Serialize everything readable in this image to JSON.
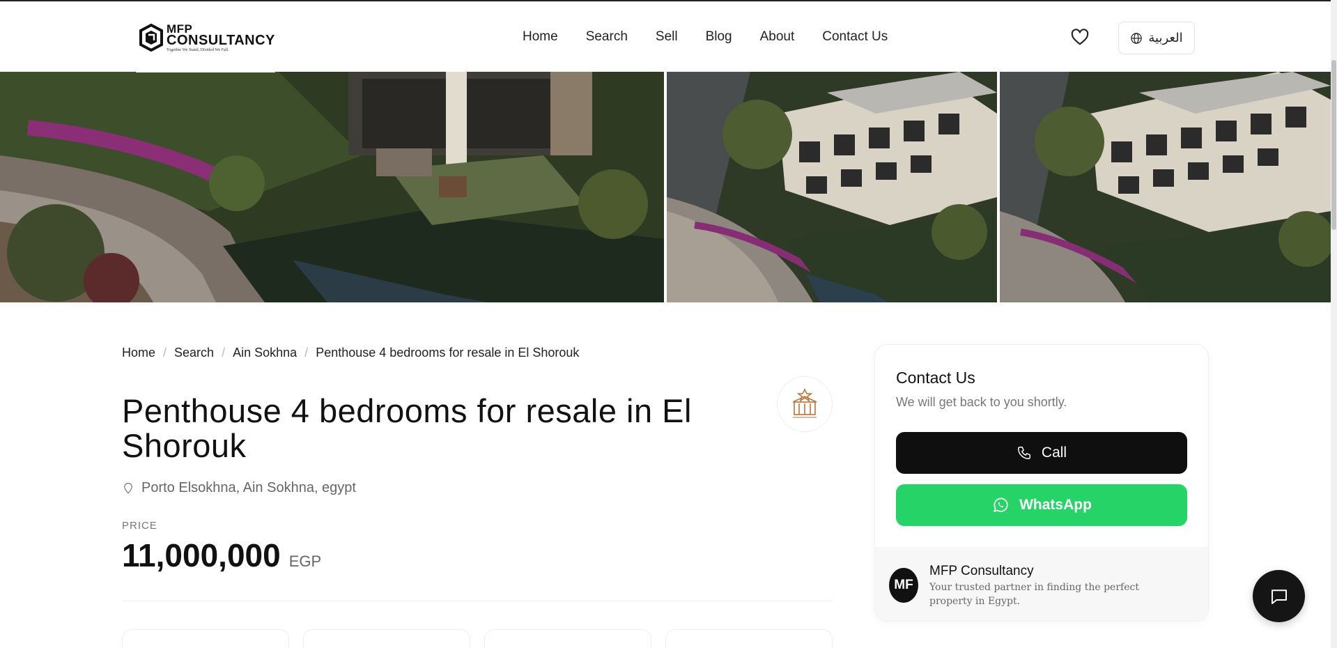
{
  "brand": {
    "name_line1": "MFP",
    "name_line2": "CONSULTANCY",
    "tagline": "Together We Stand, Divided We Fall."
  },
  "nav": {
    "items": [
      "Home",
      "Search",
      "Sell",
      "Blog",
      "About",
      "Contact Us"
    ]
  },
  "header": {
    "language_label": "العربية",
    "favorites_icon": "heart-icon",
    "language_icon": "globe-icon"
  },
  "breadcrumb": [
    "Home",
    "Search",
    "Ain Sokhna",
    "Penthouse 4 bedrooms for resale in El Shorouk"
  ],
  "listing": {
    "title": "Penthouse 4 bedrooms for resale in El Shorouk",
    "location": "Porto Elsokhna, Ain Sokhna, egypt",
    "price_label": "PRICE",
    "price": "11,000,000",
    "currency": "EGP"
  },
  "contact": {
    "title": "Contact Us",
    "subtitle": "We will get back to you shortly.",
    "call_label": "Call",
    "whatsapp_label": "WhatsApp",
    "agent_initials": "MF",
    "agent_name": "MFP Consultancy",
    "agent_desc": "Your trusted partner in finding the perfect property in Egypt."
  },
  "colors": {
    "whatsapp": "#25d366",
    "dark": "#0f0f0f"
  }
}
